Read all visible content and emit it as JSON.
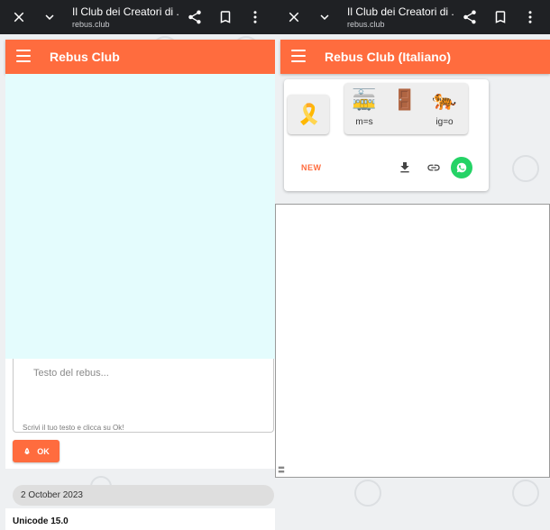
{
  "browser": {
    "title": "Il Club dei Creatori di ...",
    "url": "rebus.club"
  },
  "left": {
    "app_title": "Rebus Club",
    "input": {
      "placeholder": "Testo del rebus...",
      "helper": "Scrivi il tuo testo e clicca su Ok!"
    },
    "ok_label": "OK",
    "date": "2 October 2023",
    "entry_title": "Unicode 15.0"
  },
  "right": {
    "app_title": "Rebus Club (Italiano)",
    "rebus": {
      "tile1": {
        "emoji": "🎗️"
      },
      "tile2": [
        {
          "emoji": "🚋",
          "sub": "m=s"
        },
        {
          "emoji": "🚪",
          "sub": ""
        },
        {
          "emoji": "🐅",
          "sub": "ig=o"
        }
      ]
    },
    "new_label": "NEW",
    "icons": [
      "download-icon",
      "link-icon",
      "whatsapp-icon"
    ]
  },
  "colors": {
    "accent": "#ff6c3e",
    "whatsapp": "#25d366",
    "cyan_panel": "#e4fcfd"
  }
}
